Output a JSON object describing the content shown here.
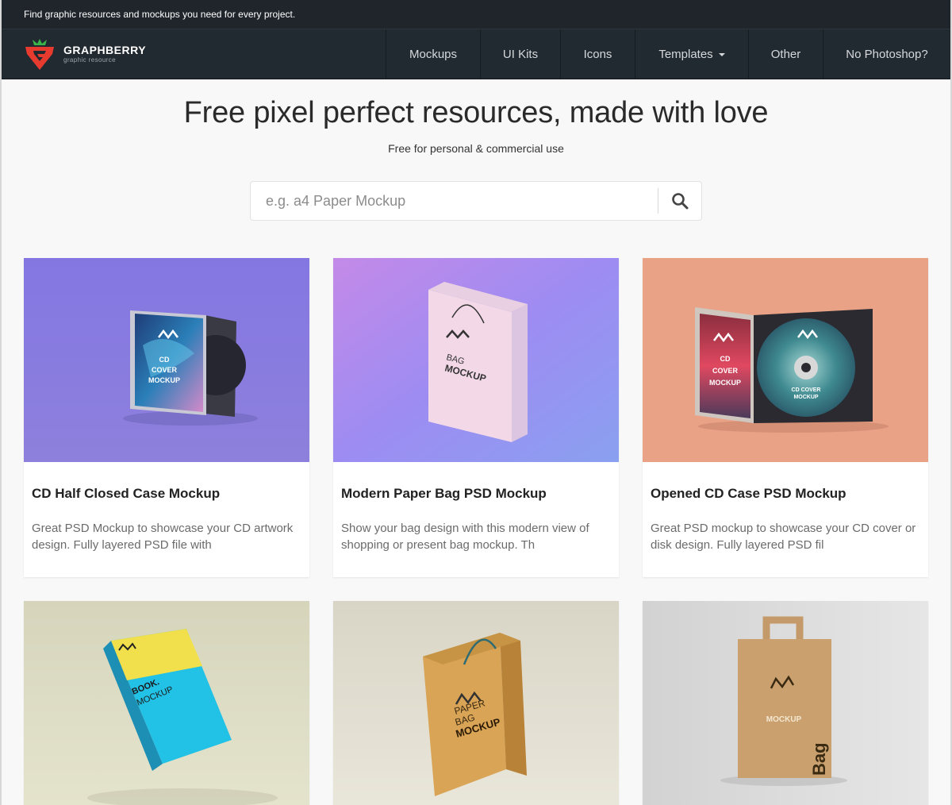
{
  "topbar": {
    "text": "Find graphic resources and mockups you need for every project."
  },
  "brand": {
    "name": "GRAPHBERRY",
    "tagline": "graphic resource",
    "colors": {
      "red": "#e63b2e",
      "green": "#3bb54a"
    }
  },
  "nav": {
    "items": [
      {
        "label": "Mockups"
      },
      {
        "label": "UI Kits"
      },
      {
        "label": "Icons"
      },
      {
        "label": "Templates",
        "dropdown": true
      },
      {
        "label": "Other"
      },
      {
        "label": "No Photoshop?"
      }
    ]
  },
  "hero": {
    "title": "Free pixel perfect resources, made with love",
    "subtitle": "Free for personal & commercial use"
  },
  "search": {
    "placeholder": "e.g. a4 Paper Mockup",
    "button_icon": "search-icon"
  },
  "cards": [
    {
      "title": "CD Half Closed Case Mockup",
      "description": "Great PSD Mockup to showcase your CD artwork design. Fully layered PSD file with",
      "thumb": {
        "bg": "#8a7de0",
        "cover_lines": [
          "CD",
          "COVER",
          "MOCKUP"
        ]
      }
    },
    {
      "title": "Modern Paper Bag PSD Mockup",
      "description": "Show your bag design with this modern view of shopping or present bag mockup. Th",
      "thumb": {
        "bg": "#a88cf0",
        "bag_lines": [
          "BAG",
          "MOCKUP"
        ]
      }
    },
    {
      "title": "Opened CD Case PSD Mockup",
      "description": "Great PSD mockup to showcase your CD cover or disk design. Fully layered PSD fil",
      "thumb": {
        "bg": "#e9a286",
        "cover_lines": [
          "CD",
          "COVER",
          "MOCKUP"
        ],
        "disc_lines": [
          "CD COVER",
          "MOCKUP"
        ]
      }
    },
    {
      "title": "",
      "description": "",
      "thumb": {
        "bg": "#dcdcc2",
        "book_lines": [
          "BOOK.",
          "MOCKUP"
        ]
      }
    },
    {
      "title": "",
      "description": "",
      "thumb": {
        "bg": "#e0ddd0",
        "bag_lines": [
          "PAPER",
          "BAG",
          "MOCKUP"
        ]
      }
    },
    {
      "title": "",
      "description": "",
      "thumb": {
        "bg": "#dcdcdc",
        "kraft_lines": [
          "MOCKUP",
          "Bag"
        ]
      }
    }
  ]
}
